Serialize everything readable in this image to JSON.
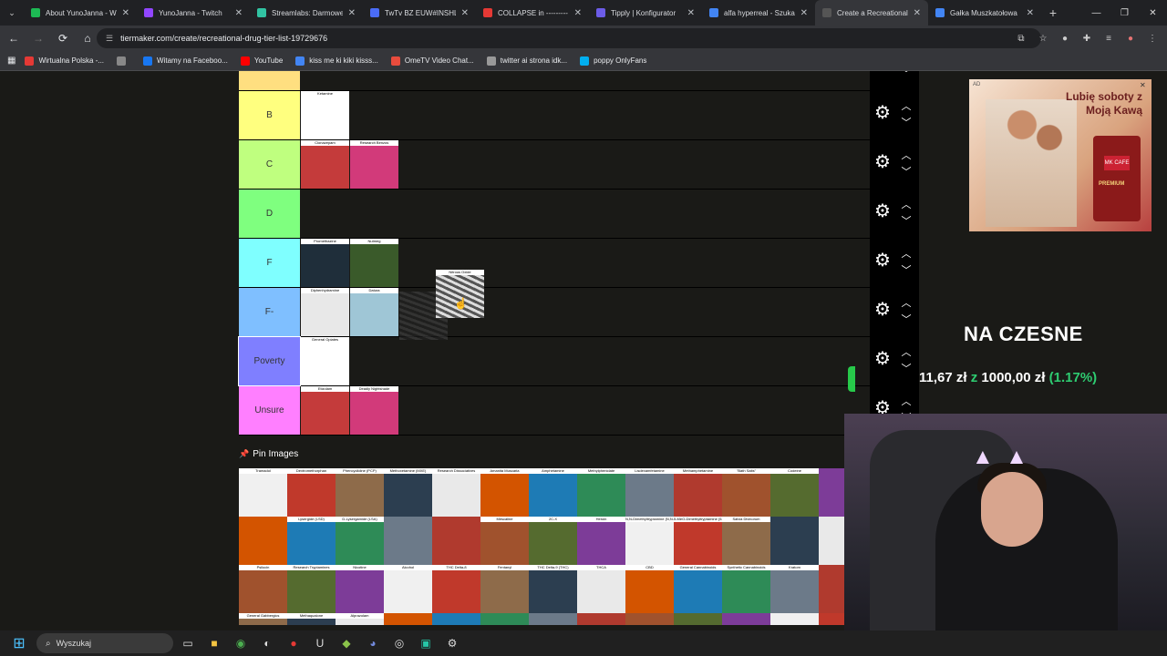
{
  "tabs": [
    {
      "label": "About YunoJanna - W",
      "color": "#1db954",
      "active": false
    },
    {
      "label": "YunoJanna - Twitch",
      "color": "#9146ff",
      "active": false
    },
    {
      "label": "Streamlabs: Darmowe",
      "color": "#31c3a2",
      "active": false
    },
    {
      "label": "TwTv BZ EUW#INSHL",
      "color": "#4a6cf7",
      "active": false
    },
    {
      "label": "COLLAPSE in ---------",
      "color": "#e53935",
      "active": false
    },
    {
      "label": "Tipply | Konfigurator",
      "color": "#6c5ce7",
      "active": false
    },
    {
      "label": "alfa hyperreal - Szuka",
      "color": "#4285f4",
      "active": false
    },
    {
      "label": "Create a Recreational",
      "color": "#555555",
      "active": true
    },
    {
      "label": "Gałka Muszkatołowa",
      "color": "#4285f4",
      "active": false
    }
  ],
  "address": {
    "url": "tiermaker.com/create/recreational-drug-tier-list-19729676"
  },
  "bookmarks": [
    {
      "label": "Wirtualna Polska -...",
      "color": "#e53935"
    },
    {
      "label": "",
      "color": "#888888"
    },
    {
      "label": "Witamy na Faceboo...",
      "color": "#1877f2"
    },
    {
      "label": "YouTube",
      "color": "#ff0000"
    },
    {
      "label": "kiss me ki kiki kisss...",
      "color": "#4285f4"
    },
    {
      "label": "OmeTV Video Chat...",
      "color": "#e84c3d"
    },
    {
      "label": "twitter ai strona idk...",
      "color": "#999999"
    },
    {
      "label": "poppy OnlyFans",
      "color": "#00aff0"
    }
  ],
  "tiers": [
    {
      "label": "",
      "color": "#ffdf80"
    },
    {
      "label": "B",
      "color": "#ffff7f"
    },
    {
      "label": "C",
      "color": "#bfff7f"
    },
    {
      "label": "D",
      "color": "#7fff7f"
    },
    {
      "label": "F",
      "color": "#7fffff"
    },
    {
      "label": "F-",
      "color": "#7fbfff"
    },
    {
      "label": "Poverty",
      "color": "#7f7fff"
    },
    {
      "label": "Unsure",
      "color": "#ff7fff"
    }
  ],
  "tier_items": {
    "B": [
      "Ketamine"
    ],
    "C": [
      "Clonazepam",
      "Research Benzos"
    ],
    "F": [
      "Promethazine",
      "Nutmeg"
    ],
    "F-": [
      "Diphenhydramine",
      "Datura"
    ],
    "Poverty": [
      "General Opiates"
    ],
    "Unsure": [
      "Etizolam",
      "Deadly Nightshade"
    ]
  },
  "dragging_item": "Nitrous Oxide",
  "pin_images_label": "Pin Images",
  "pool_rows": [
    [
      "Tramadol",
      "Dextromethorphan",
      "Phencyclidine (PCP)",
      "Methoxetamine (MXE)",
      "Research Dissociatives",
      "Amanita Muscaria",
      "Amphetamine",
      "Methylphenidate",
      "Lisdexamfetamine",
      "Methamphetamine",
      "\"Bath Salts\"",
      "Codeine",
      ""
    ],
    [
      "",
      "Lysergide (LSD)",
      "D-Lysergamide (LSA)",
      "",
      "",
      "Mescaline",
      "2C-X",
      "Heroin",
      "N,N-Dimethyltryptamine (N,N-DMT)",
      "5-MeO-Dimethyltryptamine (5-MeO-DMT)",
      "Salvia Divinorum",
      "",
      ""
    ],
    [
      "Psilocin",
      "Research Tryptamines",
      "Nicotine",
      "Alcohol",
      "THC Delta-8",
      "Fentanyl",
      "THC Delta-9 (THC)",
      "THCA",
      "CBD",
      "General Cannabinoids",
      "Synthetic Cannabinoids",
      "Kratom",
      ""
    ],
    [
      "General Gabbergics",
      "Methaqualone",
      "Alprazolam",
      "",
      "",
      "",
      "",
      "",
      "",
      "",
      "",
      "",
      ""
    ]
  ],
  "ad": {
    "label": "AD",
    "headline": "Lubię soboty z Moją Kawą",
    "brand": "MK CAFE",
    "variant": "PREMIUM"
  },
  "overlay_text": "NA CZESNE",
  "donation": {
    "current": "11,67 zł",
    "sep": "z",
    "goal": "1000,00 zł",
    "percent": "(1.17%)"
  },
  "taskbar": {
    "search_placeholder": "Wyszukaj"
  }
}
